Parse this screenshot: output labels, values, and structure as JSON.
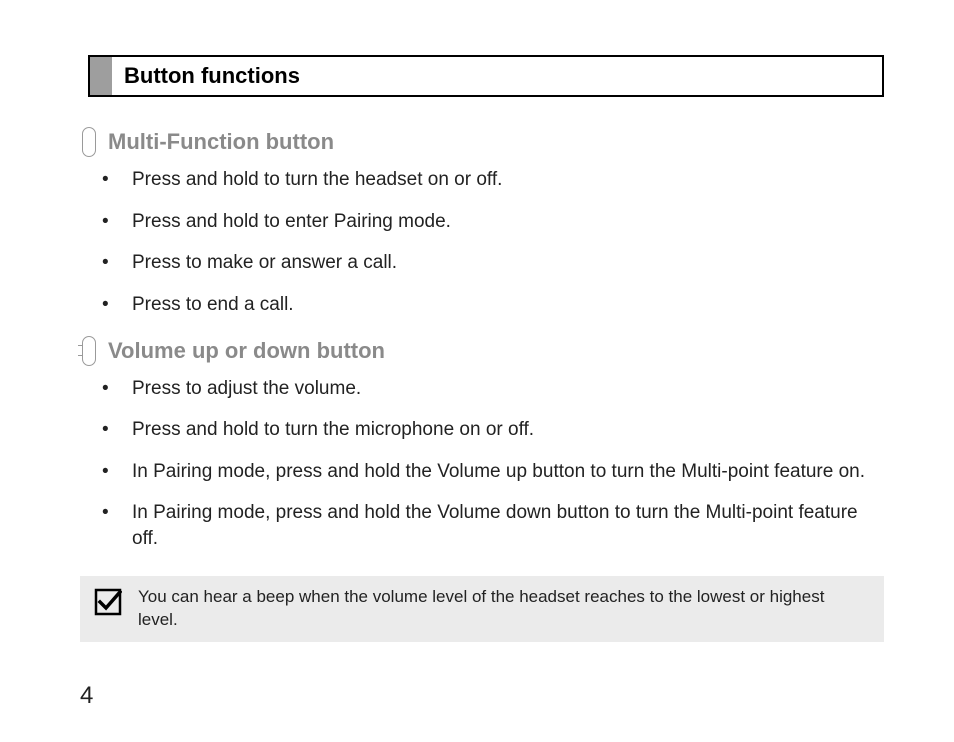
{
  "title": "Button functions",
  "sections": [
    {
      "heading": "Multi-Function button",
      "items": [
        "Press and hold to turn the headset on or off.",
        "Press and hold to enter Pairing mode.",
        "Press to make or answer a call.",
        "Press to end a call."
      ]
    },
    {
      "heading": "Volume up or down button",
      "items": [
        "Press to adjust the volume.",
        "Press and hold to turn the microphone on or off.",
        "In Pairing mode, press and hold the Volume up button to turn the Multi-point feature on.",
        "In Pairing mode, press and hold the Volume down button to turn the Multi-point feature off."
      ]
    }
  ],
  "note": "You can hear a beep when the volume level of the headset reaches to the lowest or highest level.",
  "page_number": "4"
}
